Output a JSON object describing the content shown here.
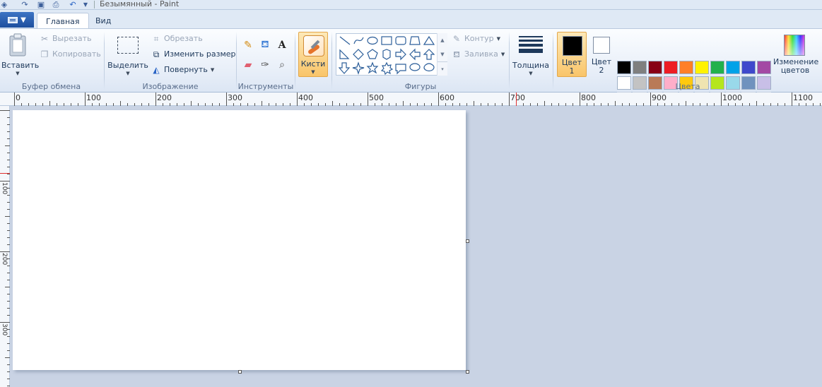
{
  "window": {
    "title": "Безымянный - Paint"
  },
  "tabs": [
    {
      "label": "Главная",
      "active": true
    },
    {
      "label": "Вид",
      "active": false
    }
  ],
  "clipboard": {
    "paste_label": "Вставить",
    "cut_label": "Вырезать",
    "copy_label": "Копировать",
    "group_label": "Буфер обмена"
  },
  "image": {
    "select_label": "Выделить",
    "crop_label": "Обрезать",
    "resize_label": "Изменить размер",
    "rotate_label": "Повернуть",
    "group_label": "Изображение"
  },
  "tools": {
    "group_label": "Инструменты",
    "text_glyph": "A"
  },
  "brushes": {
    "label": "Кисти"
  },
  "shapes": {
    "group_label": "Фигуры",
    "outline_label": "Контур",
    "fill_label": "Заливка"
  },
  "size": {
    "label": "Толщина"
  },
  "colors": {
    "group_label": "Цвета",
    "color1_label": "Цвет 1",
    "color2_label": "Цвет 2",
    "edit_label": "Изменение цветов",
    "color1_value": "#000000",
    "color2_value": "#ffffff",
    "palette_row1": [
      "#000000",
      "#7f7f7f",
      "#880015",
      "#ed1c24",
      "#ff7f27",
      "#fff200",
      "#22b14c",
      "#00a2e8",
      "#3f48cc",
      "#a349a4"
    ],
    "palette_row2": [
      "#ffffff",
      "#c3c3c3",
      "#b97a57",
      "#ffaec9",
      "#ffc90e",
      "#efe4b0",
      "#b5e61d",
      "#99d9ea",
      "#7092be",
      "#c8bfe7"
    ]
  },
  "ruler": {
    "h_labels": [
      "0",
      "100",
      "200",
      "300",
      "400",
      "500",
      "600",
      "700",
      "800",
      "900",
      "1000",
      "1100"
    ],
    "v_labels": [
      "100",
      "200",
      "300"
    ]
  }
}
